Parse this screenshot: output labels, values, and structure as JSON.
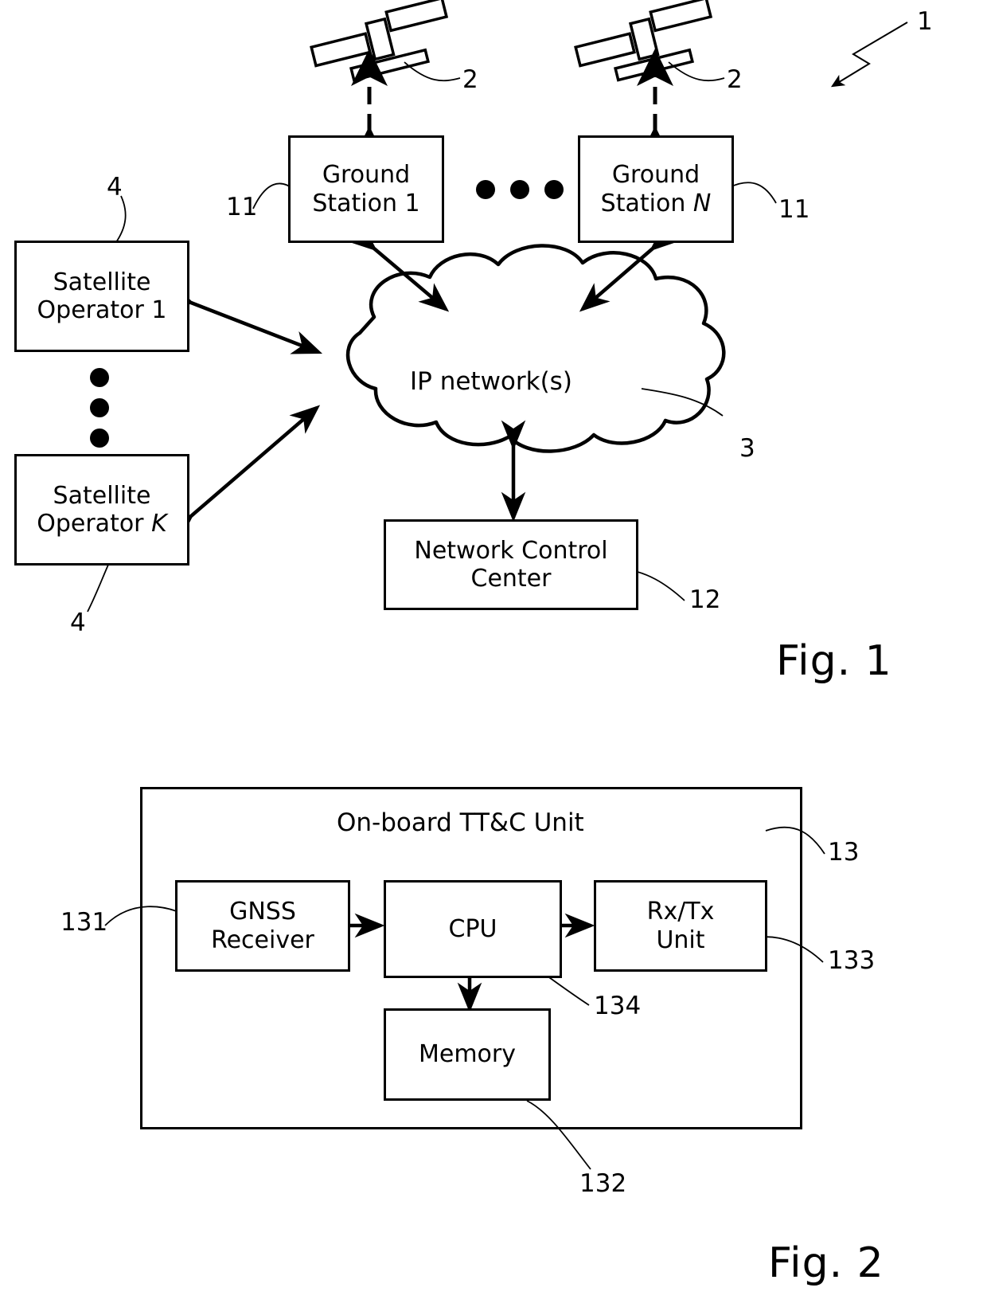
{
  "figure1": {
    "caption": "Fig. 1",
    "system_ref": "1",
    "satellites": [
      {
        "ref": "2",
        "name": "satellite-left"
      },
      {
        "ref": "2",
        "name": "satellite-right"
      }
    ],
    "ground_stations": [
      {
        "line1": "Ground",
        "line2": "Station 1",
        "italic_suffix": "",
        "ref": "11"
      },
      {
        "line1": "Ground",
        "line2": "Station ",
        "italic_suffix": "N",
        "ref": "11"
      }
    ],
    "ellipsis_dots": 3,
    "operators": [
      {
        "line1": "Satellite",
        "line2": "Operator 1",
        "italic_suffix": "",
        "ref": "4"
      },
      {
        "line1": "Satellite",
        "line2": "Operator ",
        "italic_suffix": "K",
        "ref": "4"
      }
    ],
    "operator_vertical_dots": 3,
    "cloud": {
      "label": "IP network(s)",
      "ref": "3"
    },
    "control_center": {
      "line1": "Network Control",
      "line2": "Center",
      "ref": "12"
    }
  },
  "figure2": {
    "caption": "Fig. 2",
    "unit": {
      "title": "On-board TT&C Unit",
      "ref": "13"
    },
    "blocks": [
      {
        "line1": "GNSS",
        "line2": "Receiver",
        "ref": "131"
      },
      {
        "line1": "CPU",
        "line2": "",
        "ref": "134"
      },
      {
        "line1": "Rx/Tx",
        "line2": "Unit",
        "ref": "133"
      },
      {
        "line1": "Memory",
        "line2": "",
        "ref": "132"
      }
    ]
  },
  "colors": {
    "ink": "#000000",
    "paper": "#ffffff"
  }
}
